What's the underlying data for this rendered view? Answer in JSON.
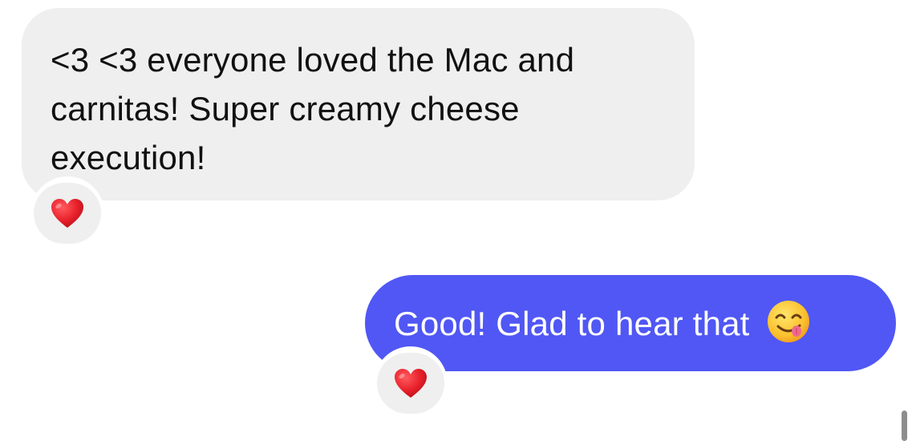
{
  "messages": [
    {
      "direction": "incoming",
      "lines": [
        "<3 <3 everyone loved the Mac and",
        "carnitas! Super creamy cheese",
        "execution!"
      ],
      "reaction": "heart-icon"
    },
    {
      "direction": "outgoing",
      "text": "Good! Glad to hear that",
      "emoji": "yum-face-icon",
      "reaction": "heart-icon"
    }
  ],
  "colors": {
    "incoming_bubble": "#efefef",
    "outgoing_bubble": "#5057f4",
    "heart": "#e8212b"
  }
}
